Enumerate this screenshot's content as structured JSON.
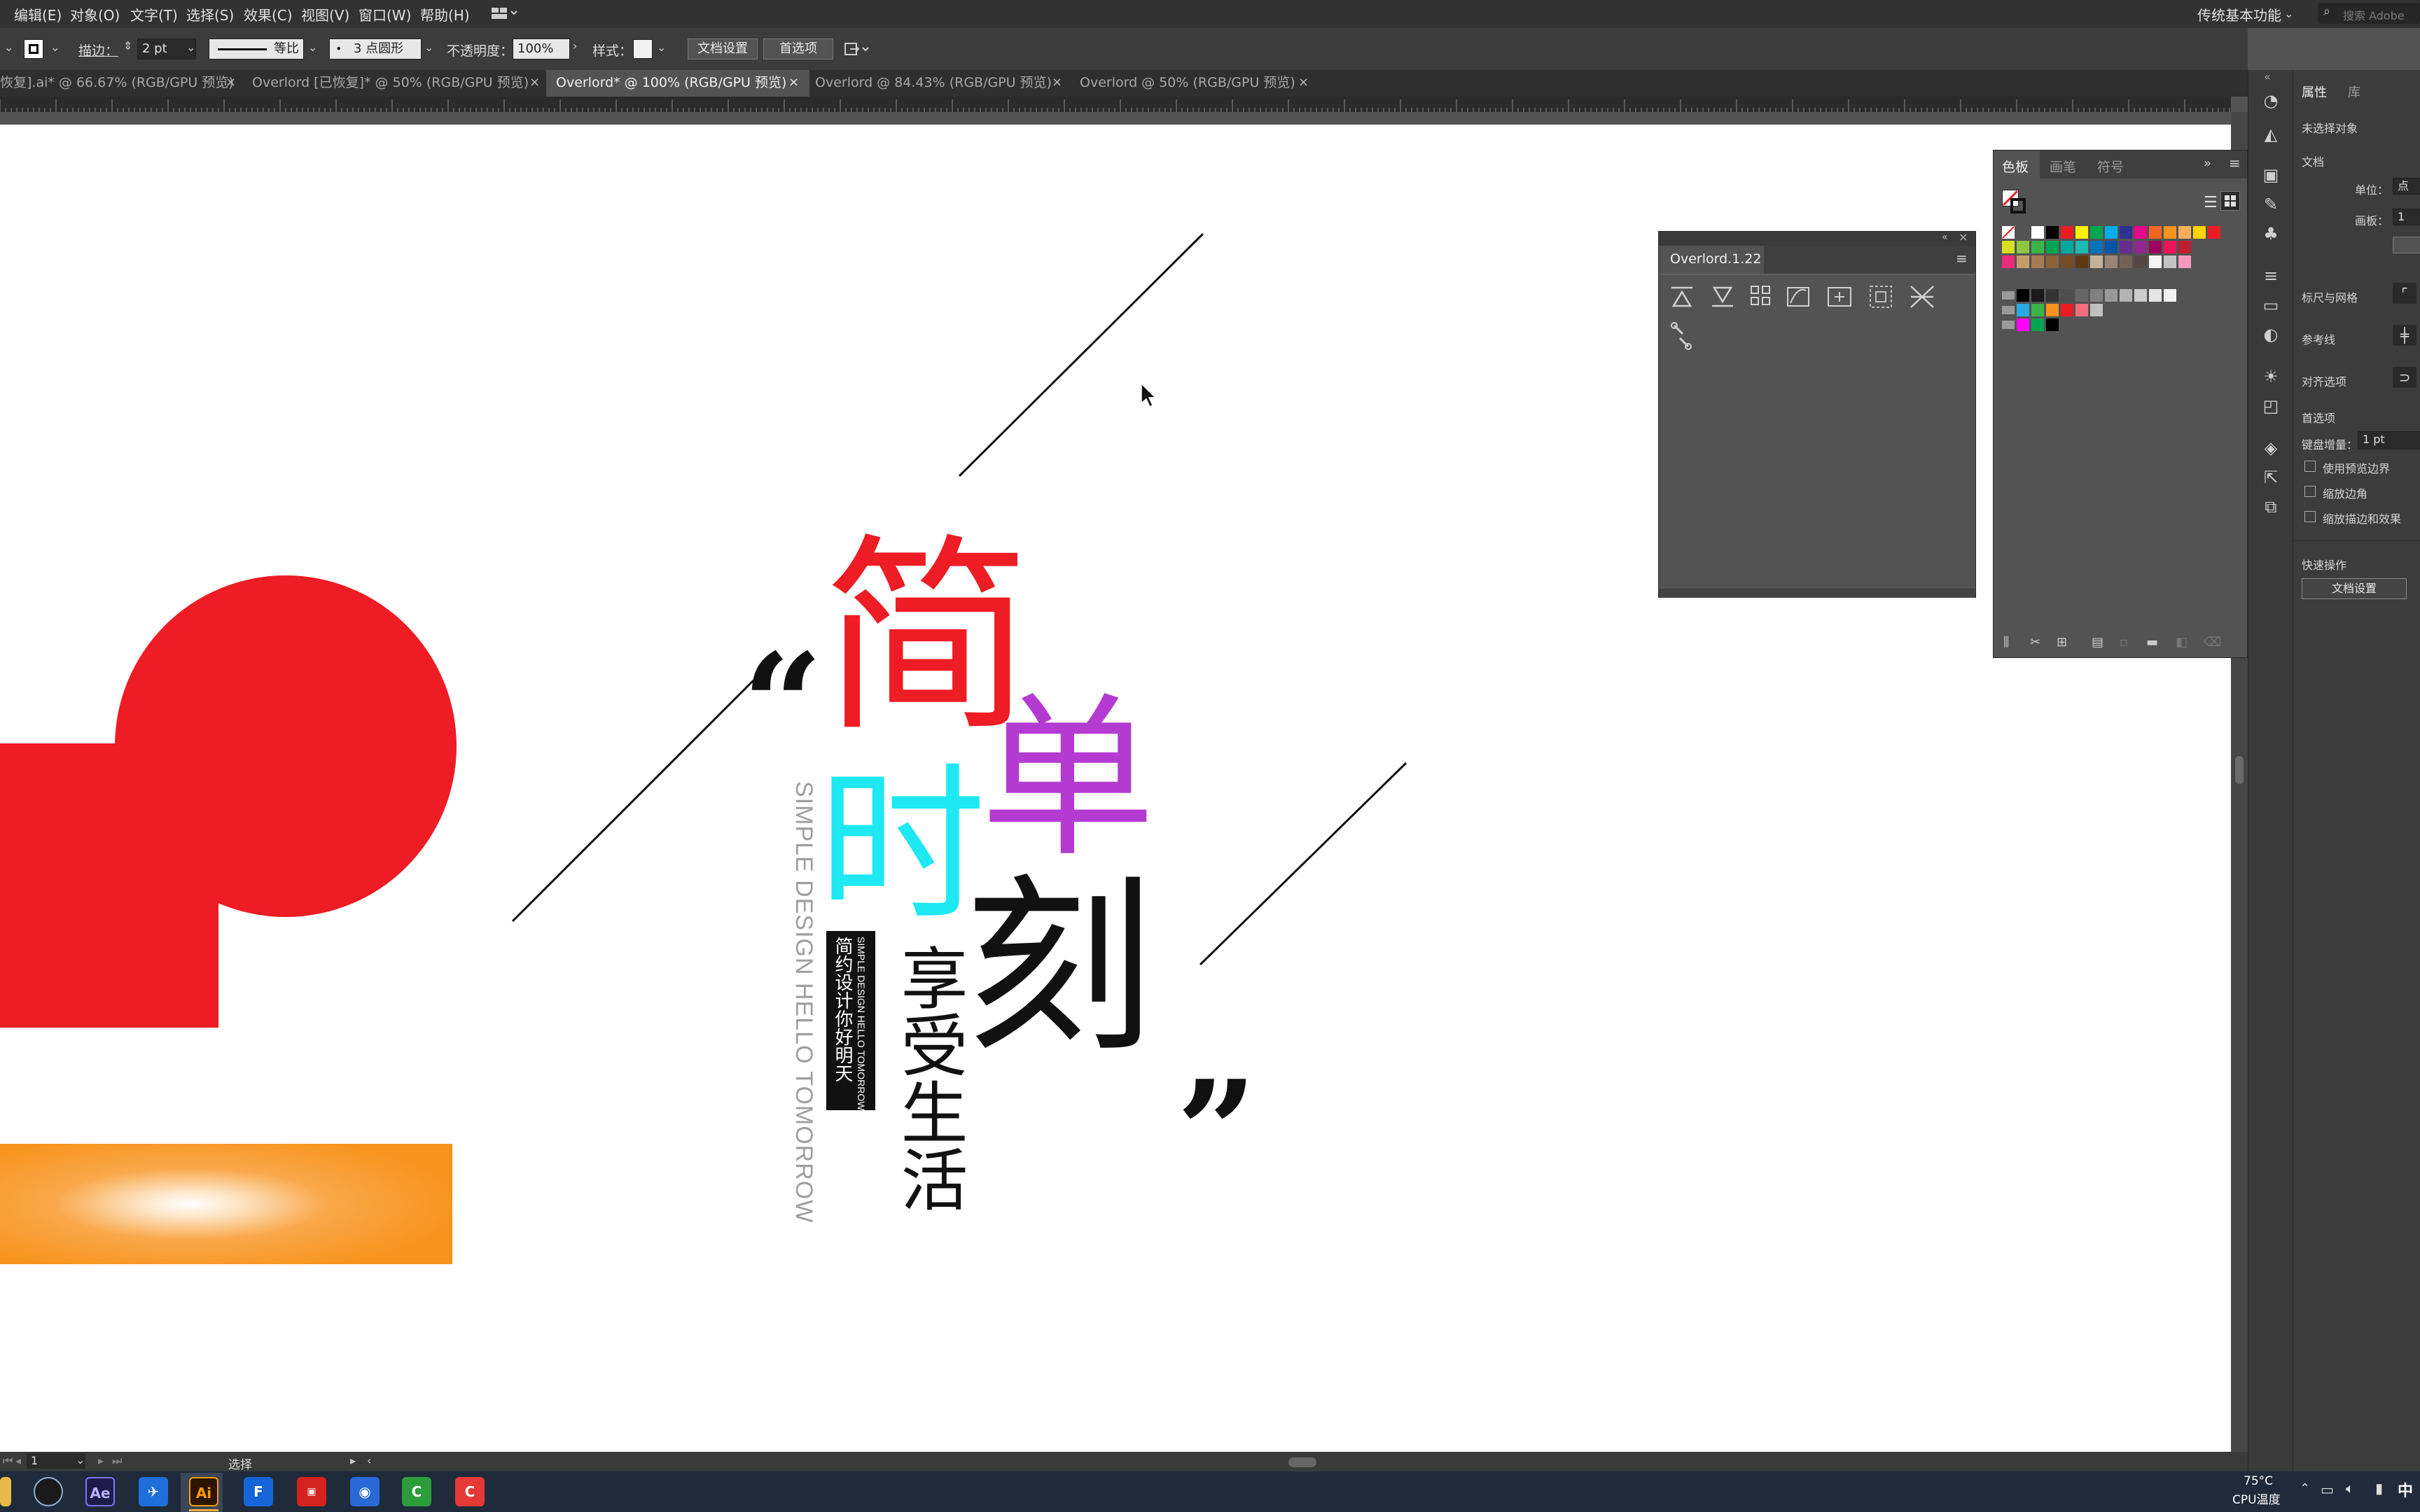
{
  "menubar": {
    "items": [
      "编辑(E)",
      "对象(O)",
      "文字(T)",
      "选择(S)",
      "效果(C)",
      "视图(V)",
      "窗口(W)",
      "帮助(H)"
    ],
    "workspace": "传统基本功能",
    "search_placeholder": "搜索 Adobe"
  },
  "controlbar": {
    "stroke_label": "描边：",
    "stroke_value": "2 pt",
    "stroke_profile": "等比",
    "brush": "3 点圆形",
    "opacity_label": "不透明度：",
    "opacity_value": "100%",
    "style_label": "样式：",
    "doc_setup_button": "文档设置",
    "preferences_button": "首选项"
  },
  "tabs": [
    {
      "title": "恢复].ai* @ 66.67% (RGB/GPU 预览)",
      "active": false
    },
    {
      "title": "Overlord [已恢复]* @ 50% (RGB/GPU 预览)",
      "active": false
    },
    {
      "title": "Overlord* @ 100% (RGB/GPU 预览)",
      "active": true
    },
    {
      "title": "Overlord @ 84.43% (RGB/GPU 预览)",
      "active": false
    },
    {
      "title": "Overlord @ 50% (RGB/GPU 预览)",
      "active": false
    }
  ],
  "close_glyph": "×",
  "artwork": {
    "char_jian": "简",
    "char_dan": "单",
    "char_shi": "时",
    "char_ke": "刻",
    "open_quote": "“",
    "close_quote": "”",
    "vertical_english": "SIMPLE DESIGN HELLO TOMORROW",
    "black_box_cn": "简约设计你好明天",
    "black_box_en": "SIMPLE DESIGN HELLO TOMORROW",
    "enjoy_life": "享受生活",
    "colors": {
      "red": "#ee1c24",
      "purple": "#b43bd2",
      "cyan": "#1ee8f2",
      "black": "#111111",
      "orange": "#f7941d",
      "gray_text": "#9e9e9e"
    }
  },
  "overlord_panel": {
    "title": "Overlord.1.22"
  },
  "swatches_panel": {
    "tabs": [
      "色板",
      "画笔",
      "符号"
    ],
    "colors_row1": [
      "#ffffff",
      "#000000",
      "#ed1c24",
      "#fff200",
      "#00a651",
      "#00aeef",
      "#2e3192",
      "#ec008c",
      "#f26522",
      "#f7941d",
      "#fbaf5d",
      "#ffd400",
      "#ed1c24"
    ],
    "colors_row2": [
      "#d7df23",
      "#8dc63f",
      "#39b54a",
      "#00a651",
      "#00a99d",
      "#1cbbb4",
      "#0072bc",
      "#0054a6",
      "#662d91",
      "#92278f",
      "#9e005d",
      "#ed145b",
      "#be1e2d"
    ],
    "colors_row3": [
      "#ee2a7b",
      "#c69c6d",
      "#a67c52",
      "#8c6239",
      "#754c24",
      "#603913",
      "#c7b299",
      "#998675",
      "#736357",
      "#534741",
      "#f5f5f5",
      "#c4c4c4",
      "#f49ac1"
    ],
    "grays": [
      "#000000",
      "#1a1a1a",
      "#333333",
      "#4d4d4d",
      "#666666",
      "#808080",
      "#999999",
      "#b3b3b3",
      "#cccccc",
      "#e6e6e6",
      "#f2f2f2"
    ],
    "group2": [
      "#29abe2",
      "#39b54a",
      "#f7931e",
      "#ed1c24",
      "#f26d7d",
      "#c0c0c0"
    ],
    "group3": [
      "#ff00ff",
      "#00a651",
      "#000000"
    ]
  },
  "properties_panel": {
    "tabs": [
      "属性",
      "库"
    ],
    "no_selection": "未选择对象",
    "document": "文档",
    "unit_label": "单位：",
    "unit_value": "点",
    "artboard_label": "画板：",
    "artboard_value": "1",
    "rulers_grids": "标尺与网格",
    "guides": "参考线",
    "snap": "对齐选项",
    "preferences": "首选项",
    "keyboard_increment_label": "键盘增量：",
    "keyboard_increment_value": "1 pt",
    "use_preview_bounds": "使用预览边界",
    "scale_corners": "缩放边角",
    "scale_strokes": "缩放描边和效果",
    "quick_actions": "快速操作",
    "doc_setup_button": "文档设置"
  },
  "statusbar": {
    "zoom": "1",
    "tool": "选择"
  },
  "taskbar": {
    "temperature": "75°C",
    "cpu_label": "CPU温度",
    "ime": "中",
    "apps": [
      "Ae",
      "Ai",
      "F"
    ]
  }
}
